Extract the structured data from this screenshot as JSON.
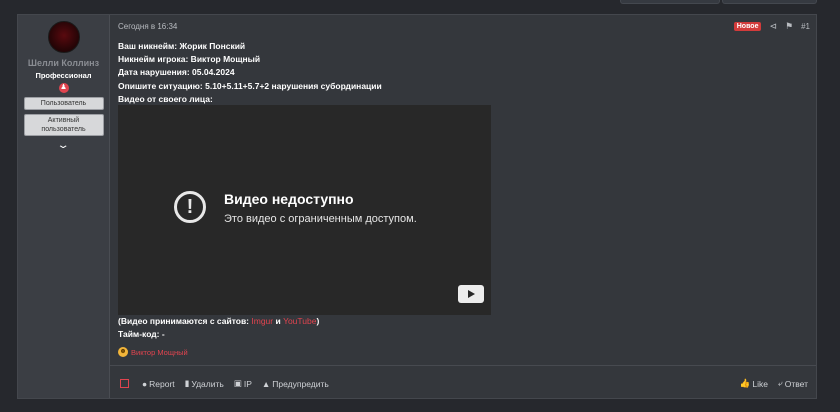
{
  "post": {
    "date": "Сегодня в 16:34",
    "badge": "Новое",
    "number": "#1",
    "icons": {
      "share": "share-icon",
      "bookmark": "bookmark-icon"
    }
  },
  "author": {
    "name": "Шелли Коллинз",
    "title": "Профессионал",
    "banners": [
      "Пользователь",
      "Активный пользователь"
    ],
    "expand_icon": "chevron-down-icon"
  },
  "content": {
    "lines": [
      "Ваш никнейм: Жорик Понский",
      "Никнейм игрока: Виктор Мощный",
      "Дата нарушения: 05.04.2024",
      "Опишите ситуацию: 5.10+5.11+5.7+2 нарушения субординации",
      "Видео от своего лица:"
    ],
    "video": {
      "title": "Видео недоступно",
      "subtitle": "Это видео с ограниченным доступом."
    },
    "sites_prefix": "(Видео принимаются с сайтов: ",
    "site1": "Imgur",
    "sites_and": " и ",
    "site2": "YouTube",
    "sites_suffix": ")",
    "timecode": "Тайм-код: -"
  },
  "reaction": {
    "user": "Виктор Мощный"
  },
  "actions": {
    "report": "Report",
    "delete": "Удалить",
    "ip": "IP",
    "warn": "Предупредить",
    "like": "Like",
    "reply": "Ответ"
  },
  "colors": {
    "accent": "#e0444f",
    "badge": "#d23b3b"
  }
}
